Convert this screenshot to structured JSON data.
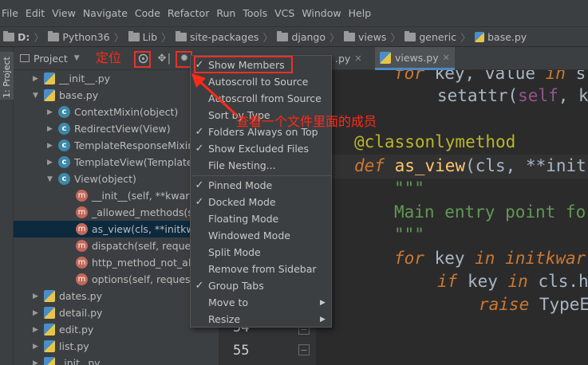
{
  "menubar": {
    "items": [
      "File",
      "Edit",
      "View",
      "Navigate",
      "Code",
      "Refactor",
      "Run",
      "Tools",
      "VCS",
      "Window",
      "Help"
    ]
  },
  "breadcrumb": {
    "items": [
      "D:",
      "Python36",
      "Lib",
      "site-packages",
      "django",
      "views",
      "generic",
      "base.py"
    ]
  },
  "sidebar": {
    "tab_label": "1: Project"
  },
  "project_panel": {
    "title": "Project",
    "tree": [
      {
        "label": "__init__.py",
        "type": "py"
      },
      {
        "label": "base.py",
        "type": "py"
      },
      {
        "label": "ContextMixin(object)",
        "type": "class"
      },
      {
        "label": "RedirectView(View)",
        "type": "class"
      },
      {
        "label": "TemplateResponseMixin",
        "type": "class"
      },
      {
        "label": "TemplateView(Template",
        "type": "class"
      },
      {
        "label": "View(object)",
        "type": "class"
      },
      {
        "label": "__init__(self, **kwargs)",
        "type": "method"
      },
      {
        "label": "_allowed_methods(se",
        "type": "method"
      },
      {
        "label": "as_view(cls, **initkwar",
        "type": "method"
      },
      {
        "label": "dispatch(self, request",
        "type": "method"
      },
      {
        "label": "http_method_not_allo",
        "type": "method"
      },
      {
        "label": "options(self, request,",
        "type": "method"
      },
      {
        "label": "dates.py",
        "type": "py"
      },
      {
        "label": "detail.py",
        "type": "py"
      },
      {
        "label": "edit.py",
        "type": "py"
      },
      {
        "label": "list.py",
        "type": "py"
      },
      {
        "label": "_init_.py",
        "type": "py"
      }
    ]
  },
  "editor": {
    "tabs": [
      ".py",
      "views.py"
    ],
    "line_numbers": [
      "54",
      "55"
    ],
    "lines": [
      "for key, value in s",
      "    setattr(self, k",
      "",
      "@classonlymethod",
      "def as_view(cls, **init",
      "\"\"\"",
      "Main entry point fo",
      "\"\"\"",
      "for key in initkwar",
      "    if key in cls.h",
      "        raise TypeE"
    ]
  },
  "context_menu": {
    "items": [
      {
        "label": "Show Members",
        "checked": true,
        "submenu": false
      },
      {
        "label": "Autoscroll to Source",
        "checked": false,
        "submenu": false
      },
      {
        "label": "Autoscroll from Source",
        "checked": false,
        "submenu": false
      },
      {
        "label": "Sort by Type",
        "checked": false,
        "submenu": false
      },
      {
        "label": "Folders Always on Top",
        "checked": true,
        "submenu": false
      },
      {
        "label": "Show Excluded Files",
        "checked": true,
        "submenu": false
      },
      {
        "label": "File Nesting...",
        "checked": false,
        "submenu": false
      },
      {
        "label": "Pinned Mode",
        "checked": true,
        "submenu": false
      },
      {
        "label": "Docked Mode",
        "checked": true,
        "submenu": false
      },
      {
        "label": "Floating Mode",
        "checked": false,
        "submenu": false
      },
      {
        "label": "Windowed Mode",
        "checked": false,
        "submenu": false
      },
      {
        "label": "Split Mode",
        "checked": false,
        "submenu": false
      },
      {
        "label": "Remove from Sidebar",
        "checked": false,
        "submenu": false
      },
      {
        "label": "Group Tabs",
        "checked": true,
        "submenu": false
      },
      {
        "label": "Move to",
        "checked": false,
        "submenu": true
      },
      {
        "label": "Resize",
        "checked": false,
        "submenu": true
      }
    ],
    "check_glyph": "✓",
    "submenu_glyph": "▶"
  },
  "annotations": {
    "locate": "定位",
    "view_members": "查看一个文件里面的成员"
  },
  "colors": {
    "annotation": "#ff2a1a",
    "selection": "#0d293e",
    "class_badge": "#3d88a8",
    "method_badge": "#c2685a"
  }
}
